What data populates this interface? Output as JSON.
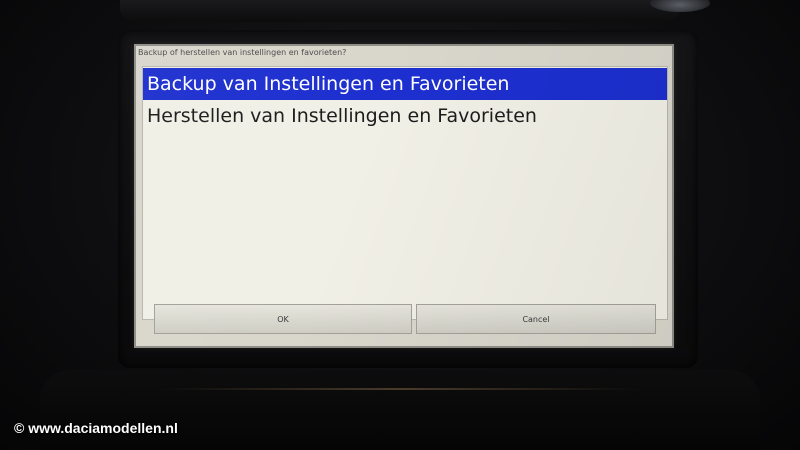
{
  "dialog": {
    "title": "Backup of herstellen van instellingen en favorieten?",
    "items": [
      {
        "label": "Backup van Instellingen en Favorieten",
        "selected": true
      },
      {
        "label": "Herstellen van Instellingen en Favorieten",
        "selected": false
      }
    ],
    "ok_label": "OK",
    "cancel_label": "Cancel"
  },
  "watermark": "© www.daciamodellen.nl",
  "colors": {
    "selection": "#1d2fcf",
    "list_background": "#f1f0e6",
    "dialog_background": "#d9d7cc"
  }
}
